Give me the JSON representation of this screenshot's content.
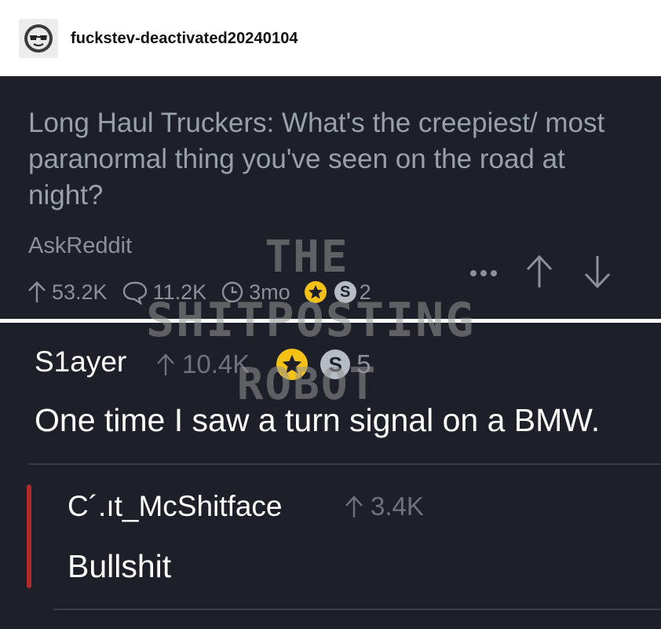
{
  "tumblr": {
    "blog_name": "fuckstev-deactivated20240104"
  },
  "post": {
    "title": "Long Haul Truckers: What's the creepiest/ most paranormal thing you've seen on the road at night?",
    "subreddit": "AskReddit",
    "upvotes": "53.2K",
    "comments": "11.2K",
    "age": "3mo",
    "silver_count": "2",
    "icons": {
      "upvote": "arrow-up-icon",
      "comments": "comment-bubble-icon",
      "age": "clock-icon",
      "gold_award": "star-award-icon",
      "silver_award": "silver-award-icon",
      "more": "more-dots-icon",
      "vote_up": "arrow-up-icon",
      "vote_down": "arrow-down-icon"
    }
  },
  "comment": {
    "user": "S1ayer",
    "upvotes": "10.4K",
    "silver_count": "5",
    "body": "One time I saw a turn signal on a BMW."
  },
  "reply": {
    "user": "C´.ıt_McShitface",
    "upvotes": "3.4K",
    "body": "Bullshit"
  },
  "watermark": {
    "line1": "THE",
    "line2": "SHITPOSTING",
    "line3": "ROBOT"
  },
  "colors": {
    "panel_bg": "#1d1f29",
    "muted_text": "#8c9198",
    "gold": "#f4c117",
    "reply_bar": "#b12a2a"
  }
}
